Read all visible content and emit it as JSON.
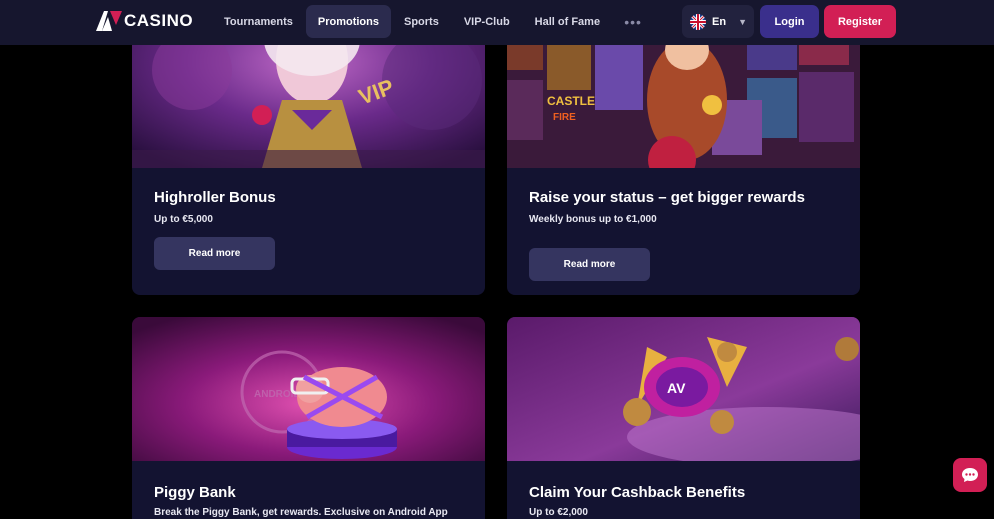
{
  "header": {
    "logo_text": "CASINO",
    "nav": [
      {
        "label": "Tournaments"
      },
      {
        "label": "Promotions"
      },
      {
        "label": "Sports"
      },
      {
        "label": "VIP-Club"
      },
      {
        "label": "Hall of Fame"
      }
    ],
    "more_label": "•••",
    "language": "En",
    "login_label": "Login",
    "register_label": "Register"
  },
  "promotions": [
    {
      "title": "Highroller Bonus",
      "subtitle": "Up to €5,000",
      "button": "Read more"
    },
    {
      "title": "Raise your status – get bigger rewards",
      "subtitle": "Weekly bonus up to €1,000",
      "button": "Read more"
    },
    {
      "title": "Piggy Bank",
      "subtitle": "Break the Piggy Bank, get rewards. Exclusive on Android App"
    },
    {
      "title": "Claim Your Cashback Benefits",
      "subtitle": "Up to €2,000"
    }
  ],
  "colors": {
    "header_bg": "#16162e",
    "card_bg": "#131331",
    "login": "#3a2f8c",
    "register": "#d21f55",
    "button": "#353560"
  },
  "icons": [
    "logo-mark-icon",
    "uk-flag-icon",
    "chevron-down-icon",
    "chat-icon"
  ]
}
